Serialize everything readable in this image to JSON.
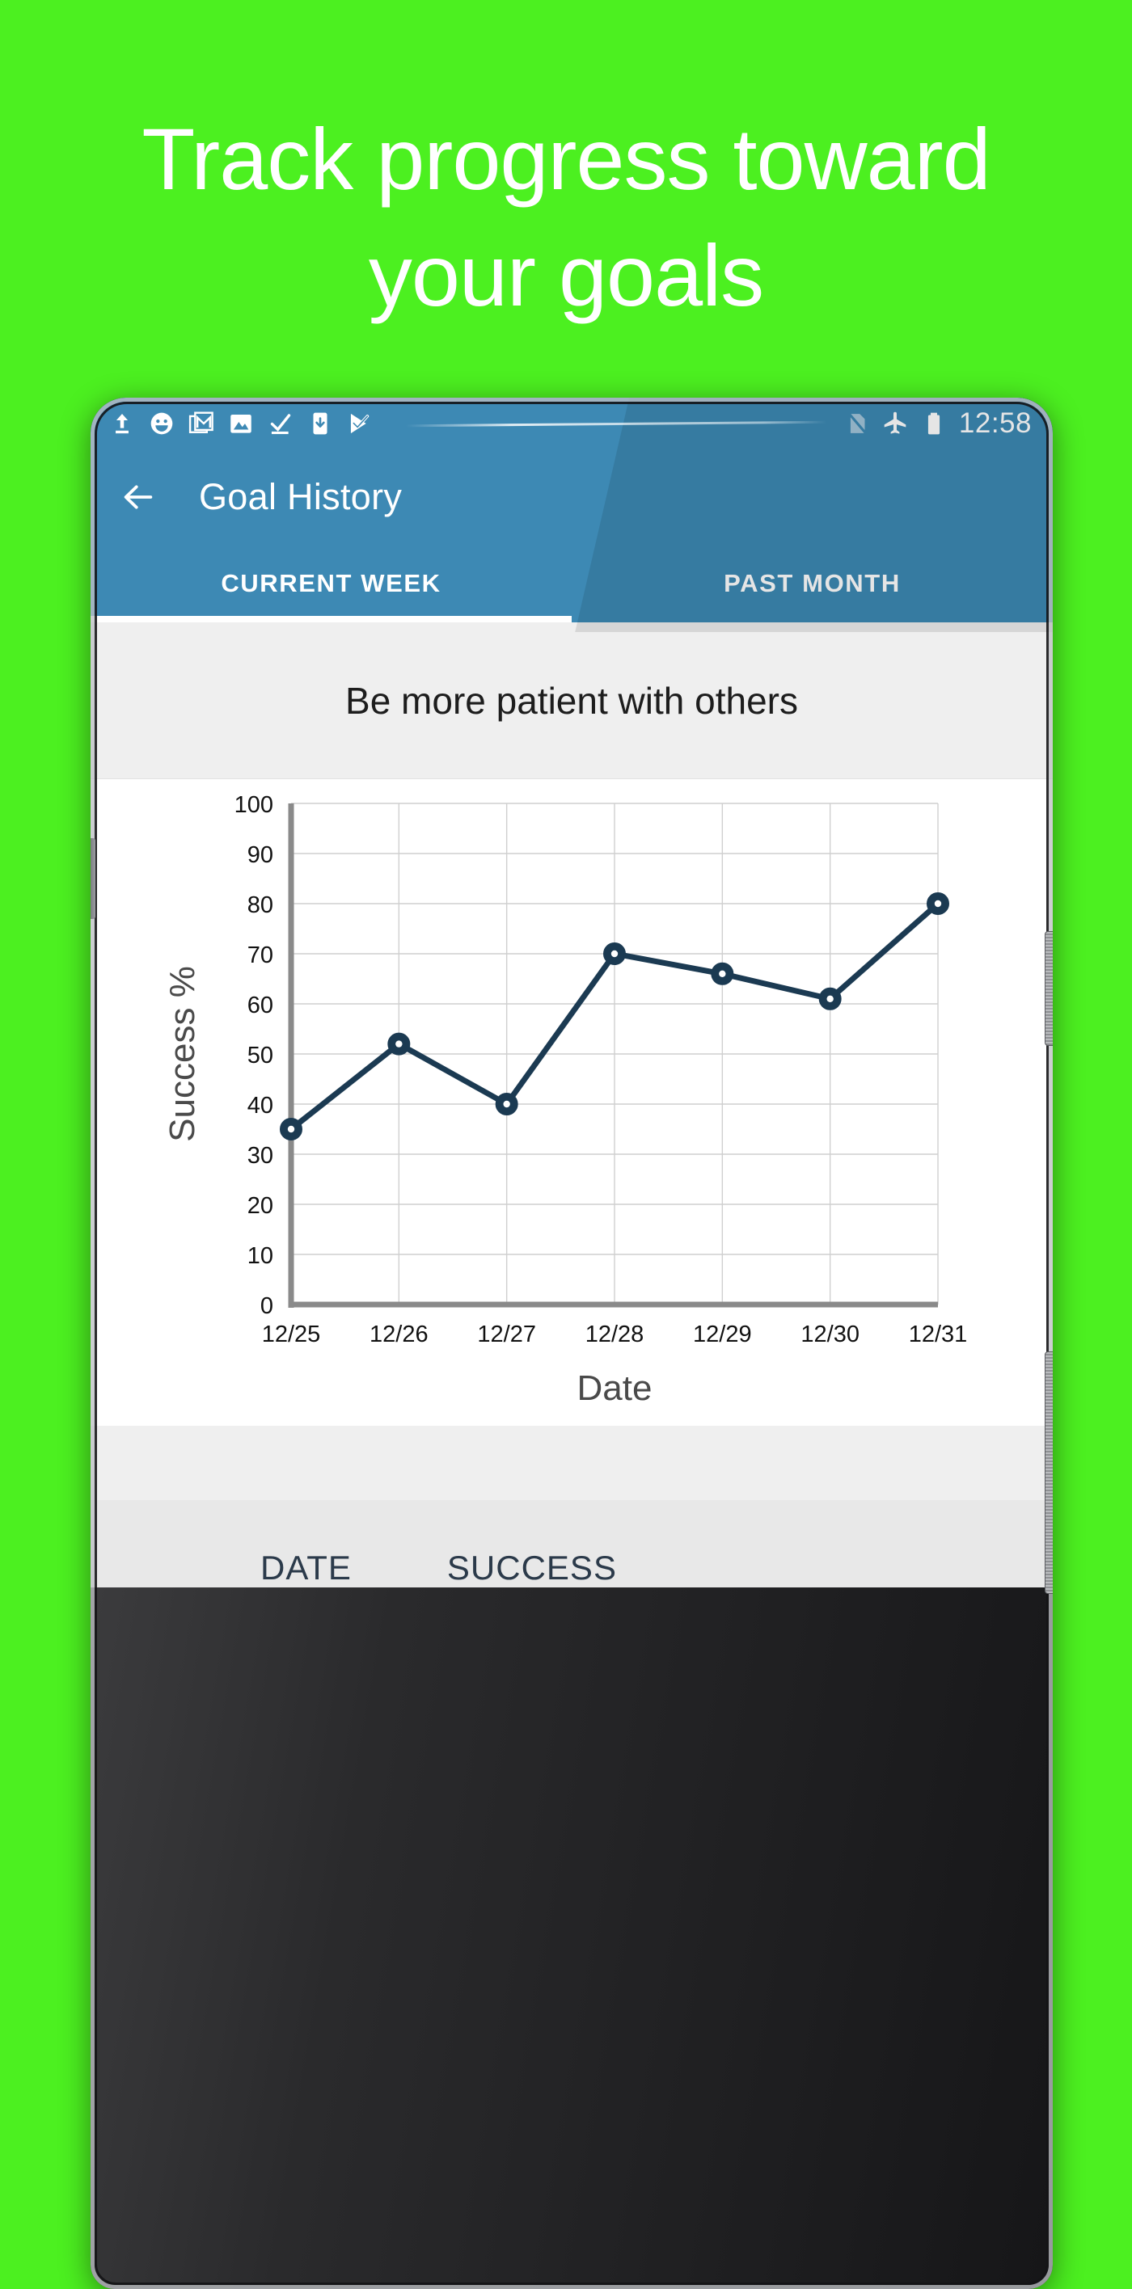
{
  "promo": {
    "headline": "Track progress toward\nyour goals",
    "background_color": "#4cf020",
    "text_color": "#ffffff"
  },
  "statusbar": {
    "icons": [
      {
        "name": "upload-icon",
        "glyph": "upload"
      },
      {
        "name": "emoji-face-icon",
        "glyph": "smiley"
      },
      {
        "name": "gmail-icon",
        "glyph": "gmail"
      },
      {
        "name": "photo-icon",
        "glyph": "photo"
      },
      {
        "name": "checkmark-underline-icon",
        "glyph": "check-line"
      },
      {
        "name": "phone-download-icon",
        "glyph": "phone-down"
      },
      {
        "name": "play-check-icon",
        "glyph": "play-check"
      }
    ],
    "right_icons": [
      {
        "name": "no-sim-icon",
        "glyph": "no-sim"
      },
      {
        "name": "airplane-mode-icon",
        "glyph": "airplane"
      },
      {
        "name": "battery-icon",
        "glyph": "battery"
      }
    ],
    "time": "12:58",
    "background_color": "#3d89b4"
  },
  "appbar": {
    "back_label": "Back",
    "title": "Goal History"
  },
  "tabs": [
    {
      "label": "CURRENT WEEK",
      "active": true
    },
    {
      "label": "PAST MONTH",
      "active": false
    }
  ],
  "goal": {
    "title": "Be more patient with others"
  },
  "table": {
    "columns": [
      "DATE",
      "SUCCESS"
    ]
  },
  "chart_data": {
    "type": "line",
    "title": "",
    "xlabel": "Date",
    "ylabel": "Success %",
    "categories": [
      "12/25",
      "12/26",
      "12/27",
      "12/28",
      "12/29",
      "12/30",
      "12/31"
    ],
    "values": [
      35,
      52,
      40,
      70,
      66,
      61,
      80
    ],
    "ylim": [
      0,
      100
    ],
    "yticks": [
      0,
      10,
      20,
      30,
      40,
      50,
      60,
      70,
      80,
      90,
      100
    ],
    "grid": true,
    "legend": "none",
    "series_color": "#1b3a52",
    "marker": "circle-open",
    "grid_color": "#cfcfcf",
    "axis_color": "#8a8a8a"
  }
}
